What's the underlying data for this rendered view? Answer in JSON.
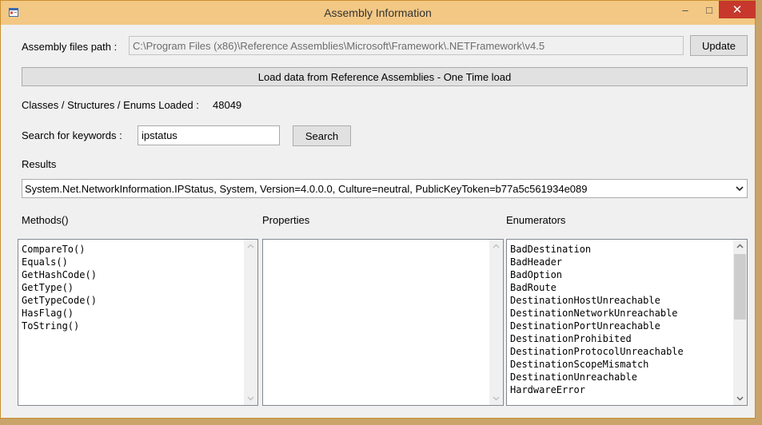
{
  "window": {
    "title": "Assembly Information",
    "controls": {
      "minimize": "–",
      "maximize": "□",
      "close": "✕"
    }
  },
  "path": {
    "label": "Assembly files path :",
    "value": "C:\\Program Files (x86)\\Reference Assemblies\\Microsoft\\Framework\\.NETFramework\\v4.5",
    "update_label": "Update"
  },
  "load_button_label": "Load data from Reference Assemblies - One Time load",
  "loaded": {
    "label": "Classes / Structures / Enums Loaded :",
    "count": "48049"
  },
  "search": {
    "label": "Search for keywords :",
    "value": "ipstatus",
    "button_label": "Search"
  },
  "results": {
    "label": "Results",
    "selected": "System.Net.NetworkInformation.IPStatus, System, Version=4.0.0.0, Culture=neutral, PublicKeyToken=b77a5c561934e089"
  },
  "methods": {
    "label": "Methods()",
    "items": [
      "CompareTo()",
      "Equals()",
      "GetHashCode()",
      "GetType()",
      "GetTypeCode()",
      "HasFlag()",
      "ToString()"
    ]
  },
  "properties": {
    "label": "Properties",
    "items": []
  },
  "enumerators": {
    "label": "Enumerators",
    "items": [
      "BadDestination",
      "BadHeader",
      "BadOption",
      "BadRoute",
      "DestinationHostUnreachable",
      "DestinationNetworkUnreachable",
      "DestinationPortUnreachable",
      "DestinationProhibited",
      "DestinationProtocolUnreachable",
      "DestinationScopeMismatch",
      "DestinationUnreachable",
      "HardwareError"
    ]
  },
  "colors": {
    "titlebar": "#f3c884",
    "close": "#c7372c",
    "border": "#c98f2c"
  },
  "icons": {
    "app": "app-window-icon",
    "dropdown": "chevron-down-icon",
    "scroll_up": "arrow-up-icon",
    "scroll_down": "arrow-down-icon"
  }
}
